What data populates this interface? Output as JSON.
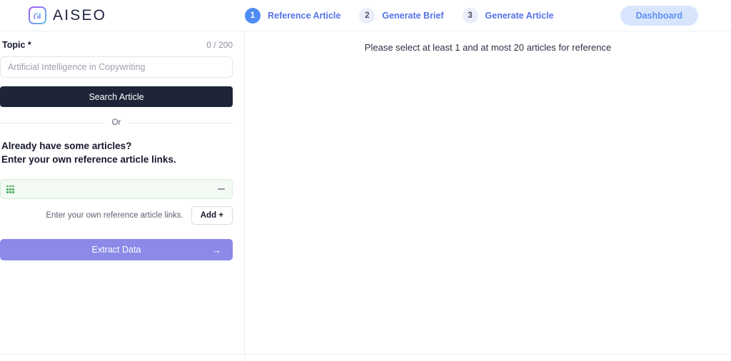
{
  "header": {
    "brand_name": "AISEO",
    "logo_icon": "aiseo-chart-logo-icon",
    "steps": [
      {
        "number": "1",
        "label": "Reference Article",
        "state": "active"
      },
      {
        "number": "2",
        "label": "Generate Brief",
        "state": "idle"
      },
      {
        "number": "3",
        "label": "Generate Article",
        "state": "idle"
      }
    ],
    "dashboard_label": "Dashboard"
  },
  "sidebar": {
    "topic_label": "Topic *",
    "topic_counter": "0 / 200",
    "topic_placeholder": "Artificial Intelligence in Copywriting",
    "topic_value": "",
    "search_label": "Search Article",
    "or_text": "Or",
    "already_heading_line1": "Already have some articles?",
    "already_heading_line2": "Enter your own reference article links.",
    "link_rows": [
      {
        "value": "",
        "placeholder": "",
        "drag_icon": "drag-handle-icon",
        "remove_icon": "minus-icon"
      }
    ],
    "add_hint": "Enter your own reference article links.",
    "add_label": "Add +",
    "extract_label": "Extract Data",
    "extract_arrow": "→"
  },
  "main": {
    "message": "Please select at least 1 and at most 20 articles for reference"
  },
  "colors": {
    "accent_blue": "#4f8df5",
    "step_label": "#5572e8",
    "dashboard_bg": "#d8e6fd",
    "dark_button": "#1e2539",
    "extract_purple": "#8b8ae8",
    "link_row_bg": "#f2faf3",
    "link_row_border": "#d6ecd9",
    "drag_handle_green": "#4fae62"
  }
}
